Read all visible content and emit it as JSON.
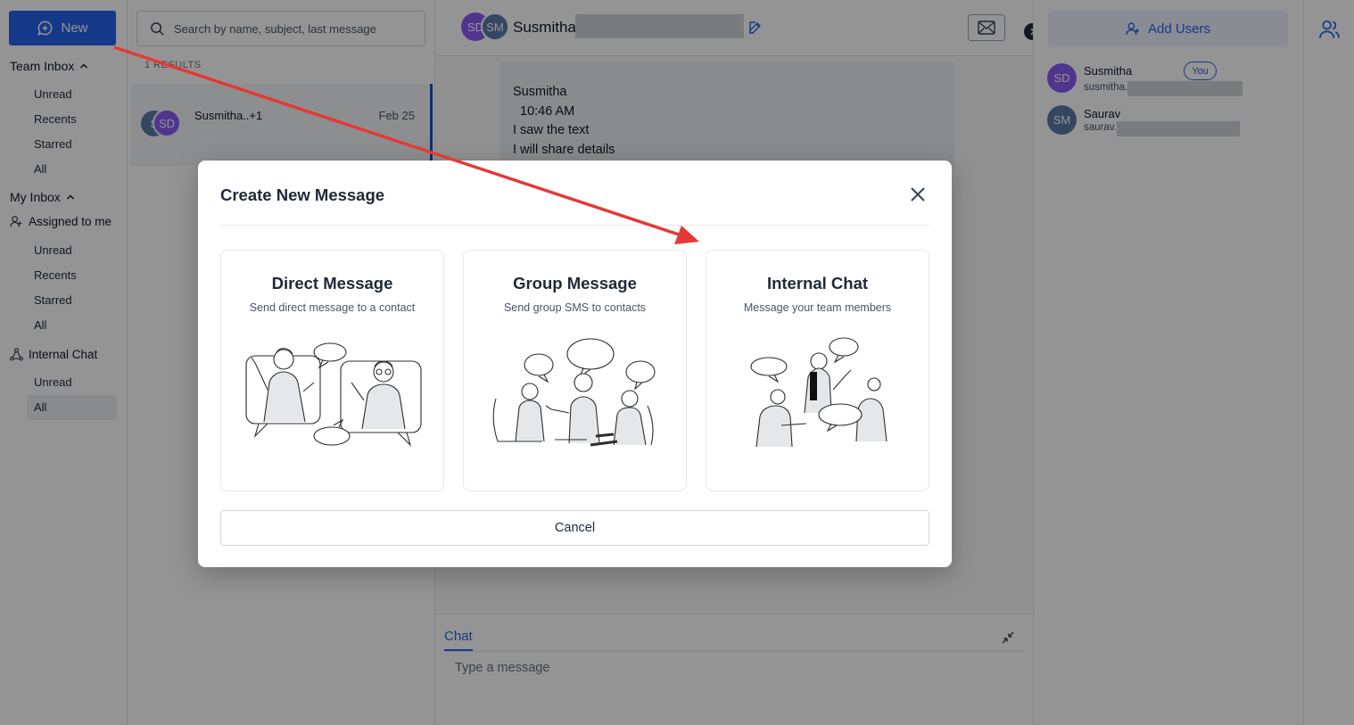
{
  "nav": {
    "new_label": "New",
    "team_inbox": "Team Inbox",
    "team_items": [
      "Unread",
      "Recents",
      "Starred",
      "All"
    ],
    "my_inbox": "My Inbox",
    "assigned_to_me": "Assigned to me",
    "my_items": [
      "Unread",
      "Recents",
      "Starred",
      "All"
    ],
    "internal_chat": "Internal Chat",
    "internal_items": [
      "Unread",
      "All"
    ]
  },
  "list": {
    "search_placeholder": "Search by name, subject, last message",
    "results": "1 RESULTS",
    "conversation": {
      "name": "Susmitha..+1",
      "date": "Feb 25",
      "avatar_back": "S",
      "avatar_front": "SD"
    }
  },
  "chat": {
    "avatar_1": "SD",
    "avatar_2": "SM",
    "title": "Susmitha",
    "message_lines": [
      "Susmitha",
      "10:46 AM",
      "I saw the text",
      "I will share details"
    ],
    "composer_tab": "Chat",
    "composer_placeholder": "Type a message"
  },
  "right": {
    "add_users": "Add Users",
    "members": [
      {
        "initials": "SD",
        "name": "Susmitha",
        "email": "susmitha.",
        "badge": "You",
        "color": "#8b5cf6"
      },
      {
        "initials": "SM",
        "name": "Saurav",
        "email": "saurav.",
        "color": "#5b7aa8"
      }
    ]
  },
  "modal": {
    "title": "Create New Message",
    "cards": [
      {
        "title": "Direct Message",
        "subtitle": "Send direct message to a contact"
      },
      {
        "title": "Group Message",
        "subtitle": "Send group SMS to contacts"
      },
      {
        "title": "Internal Chat",
        "subtitle": "Message your team members"
      }
    ],
    "cancel": "Cancel"
  },
  "colors": {
    "accent": "#2563eb",
    "annotation_arrow": "#e53935"
  }
}
